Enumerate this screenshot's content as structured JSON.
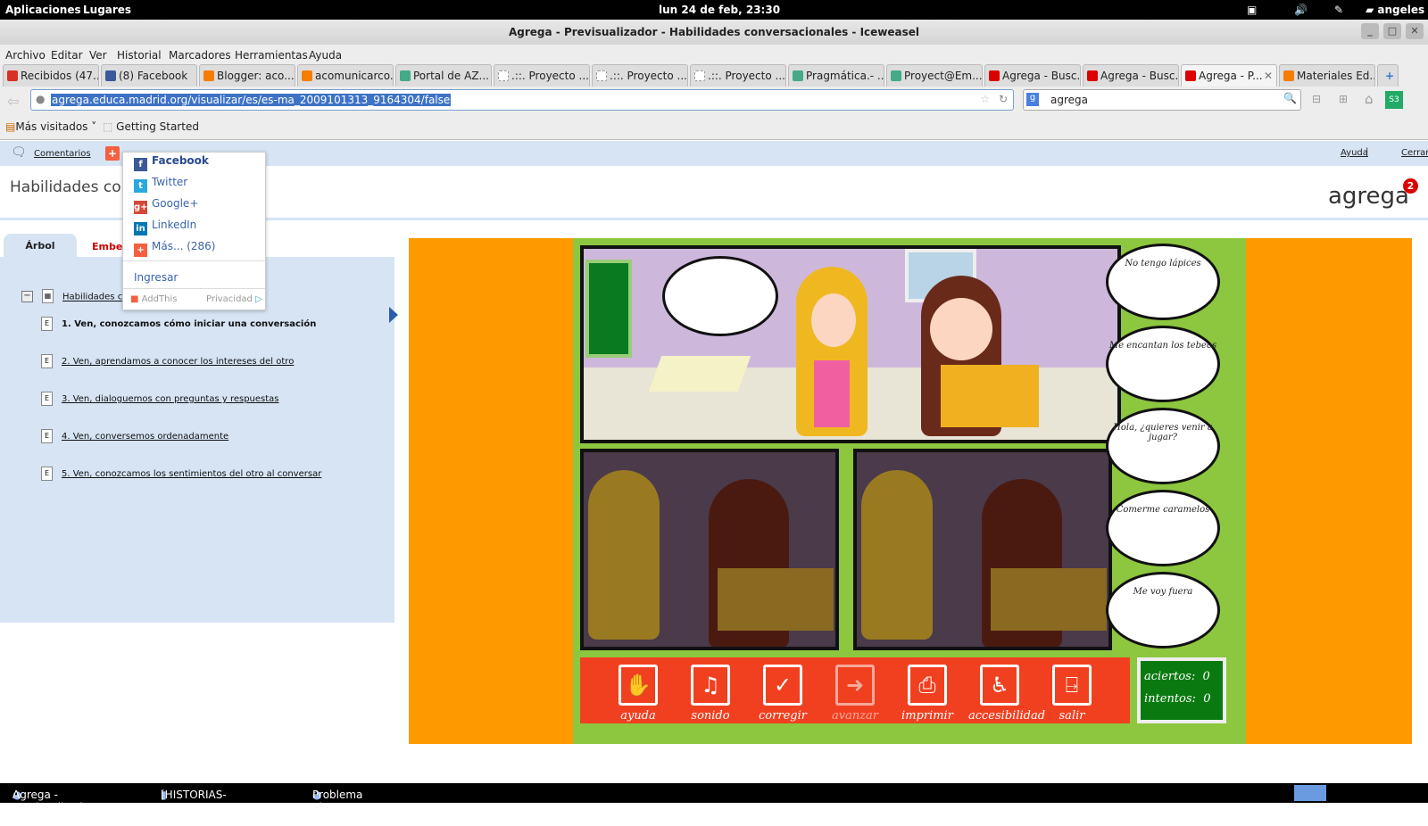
{
  "system": {
    "apps": "Aplicaciones",
    "places": "Lugares",
    "clock": "lun 24 de feb, 23:30",
    "user": "angeles"
  },
  "window": {
    "title": "Agrega - Previsualizador - Habilidades conversacionales - Iceweasel"
  },
  "menu": [
    "Archivo",
    "Editar",
    "Ver",
    "Historial",
    "Marcadores",
    "Herramientas",
    "Ayuda"
  ],
  "tabs": [
    {
      "label": "Recibidos (47...",
      "color": "#d93025"
    },
    {
      "label": "(8) Facebook",
      "color": "#3b5998"
    },
    {
      "label": "Blogger: aco...",
      "color": "#f57d00"
    },
    {
      "label": "acomunicarco...",
      "color": "#f57d00"
    },
    {
      "label": "Portal de AZ...",
      "color": "#4a8"
    },
    {
      "label": ".::. Proyecto ...",
      "color": "#fff"
    },
    {
      "label": ".::. Proyecto ...",
      "color": "#fff"
    },
    {
      "label": ".::. Proyecto ...",
      "color": "#fff"
    },
    {
      "label": "Pragmática.- ...",
      "color": "#4a8"
    },
    {
      "label": "Proyect@Em...",
      "color": "#4a8"
    },
    {
      "label": "Agrega - Busc...",
      "color": "#d00"
    },
    {
      "label": "Agrega - Busc...",
      "color": "#d00"
    },
    {
      "label": "Agrega - P...",
      "color": "#d00",
      "active": true
    },
    {
      "label": "Materiales Ed...",
      "color": "#f57d00"
    }
  ],
  "url": "agrega.educa.madrid.org/visualizar/es/es-ma_2009101313_9164304/false",
  "search": "agrega",
  "bookmarks": {
    "most_visited": "Más visitados",
    "getting_started": "Getting Started"
  },
  "page": {
    "comments": "Comentarios",
    "help": "Ayuda",
    "close": "Cerrar",
    "title": "Habilidades conv",
    "logo": "agrega",
    "logo_badge": "2",
    "tab_tree": "Árbol",
    "tab_embed": "Embeb",
    "tree_root": "Habilidades co",
    "items": [
      "1. Ven, conozcamos cómo iniciar una conversación",
      "2. Ven, aprendamos a conocer los intereses del otro",
      "3. Ven, dialoguemos con preguntas y respuestas",
      "4. Ven, conversemos ordenadamente",
      "5. Ven, conozcamos los sentimientos del otro al conversar"
    ]
  },
  "share_menu": {
    "items": [
      "Facebook",
      "Twitter",
      "Google+",
      "LinkedIn",
      "Más... (286)"
    ],
    "login": "Ingresar",
    "brand": "AddThis",
    "privacy": "Privacidad"
  },
  "game": {
    "bubbles": [
      "No tengo lápices",
      "Me encantan los tebeos",
      "Hola, ¿quieres venir a jugar?",
      "Comerme caramelos",
      "Me voy fuera"
    ],
    "buttons": [
      {
        "label": "ayuda",
        "icon": "hand-icon",
        "glyph": "✋"
      },
      {
        "label": "sonido",
        "icon": "music-icon",
        "glyph": "♫"
      },
      {
        "label": "corregir",
        "icon": "check-icon",
        "glyph": "✓"
      },
      {
        "label": "avanzar",
        "icon": "forward-icon",
        "glyph": "➜"
      },
      {
        "label": "imprimir",
        "icon": "printer-icon",
        "glyph": "⎙"
      },
      {
        "label": "accesibilidad",
        "icon": "wheelchair-icon",
        "glyph": "♿"
      },
      {
        "label": "salir",
        "icon": "exit-door-icon",
        "glyph": "⍈"
      }
    ],
    "score": {
      "hits_label": "aciertos:",
      "hits": "0",
      "tries_label": "intentos:",
      "tries": "0"
    },
    "colors": {
      "background": "#ff9900",
      "frame": "#8dc63f",
      "toolbar": "#f04020",
      "score": "#0a7a10"
    }
  },
  "taskbar": [
    "Agrega - Previsualizad...",
    "[HISTORIAS-SOCIAL...",
    "Problema al cargar la ..."
  ]
}
